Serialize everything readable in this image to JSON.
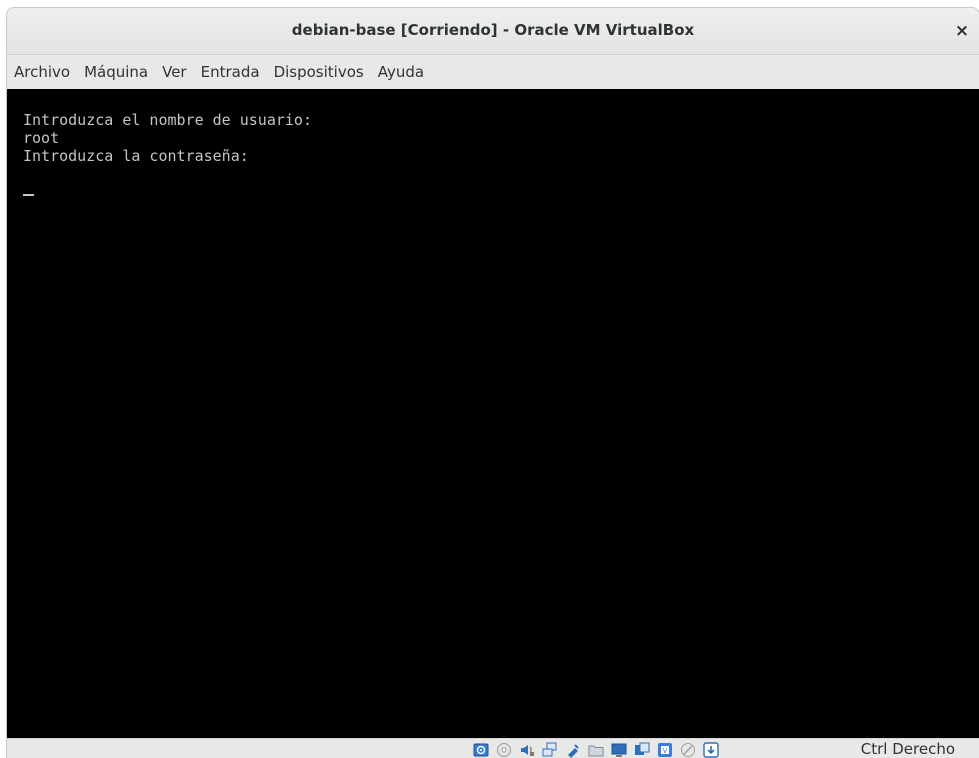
{
  "window": {
    "title": "debian-base [Corriendo] - Oracle VM VirtualBox",
    "close_label": "×"
  },
  "menubar": {
    "items": [
      "Archivo",
      "Máquina",
      "Ver",
      "Entrada",
      "Dispositivos",
      "Ayuda"
    ]
  },
  "console": {
    "lines": [
      "Introduzca el nombre de usuario:",
      "root",
      "Introduzca la contraseña:"
    ],
    "cursor": "_"
  },
  "statusbar": {
    "icons": [
      "hard-disk-icon",
      "optical-drive-icon",
      "audio-icon",
      "network-icon",
      "usb-icon",
      "shared-folders-icon",
      "display-icon",
      "video-capture-icon",
      "cpu-icon",
      "mouse-integration-icon",
      "keyboard-capture-icon"
    ],
    "host_key": "Ctrl Derecho"
  },
  "colors": {
    "titlebar_bg": "#e8e8e7",
    "screen_bg": "#000000",
    "console_text": "#c4c4c4",
    "status_icon_blue": "#2f6fb8"
  }
}
